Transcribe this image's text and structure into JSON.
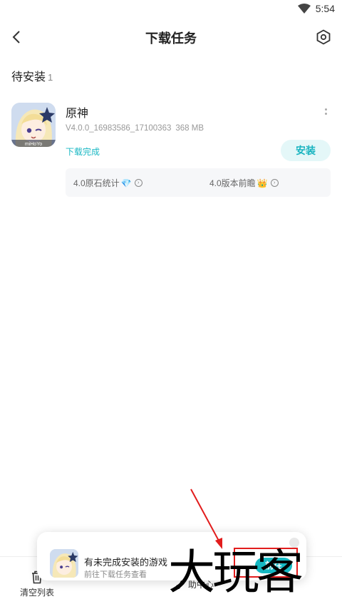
{
  "status_bar": {
    "time": "5:54",
    "icons": [
      "wifi-icon"
    ]
  },
  "header": {
    "title": "下载任务",
    "back_icon": "chevron-left-icon",
    "settings_icon": "settings-hexagon-icon"
  },
  "section": {
    "title": "待安装",
    "count": "1"
  },
  "app": {
    "name": "原神",
    "icon_text": "miHoYo",
    "version": "V4.0.0_16983586_17100363",
    "size": "368 MB",
    "status": "下载完成",
    "install_label": "安装",
    "tags": [
      {
        "label": "4.0原石统计",
        "emoji": "💎"
      },
      {
        "label": "4.0版本前瞻",
        "emoji": "👑"
      }
    ]
  },
  "bottom_bar": {
    "clear_label": "清空列表",
    "help_label": "助中心"
  },
  "toast": {
    "title": "有未完成安装的游戏",
    "subtitle": "前往下载任务查看",
    "go_label": "前往"
  },
  "watermark": {
    "text": "大玩客"
  },
  "colors": {
    "accent": "#16b8c2",
    "accent_light": "#e4f7f8",
    "annotation": "#e21d1d"
  }
}
